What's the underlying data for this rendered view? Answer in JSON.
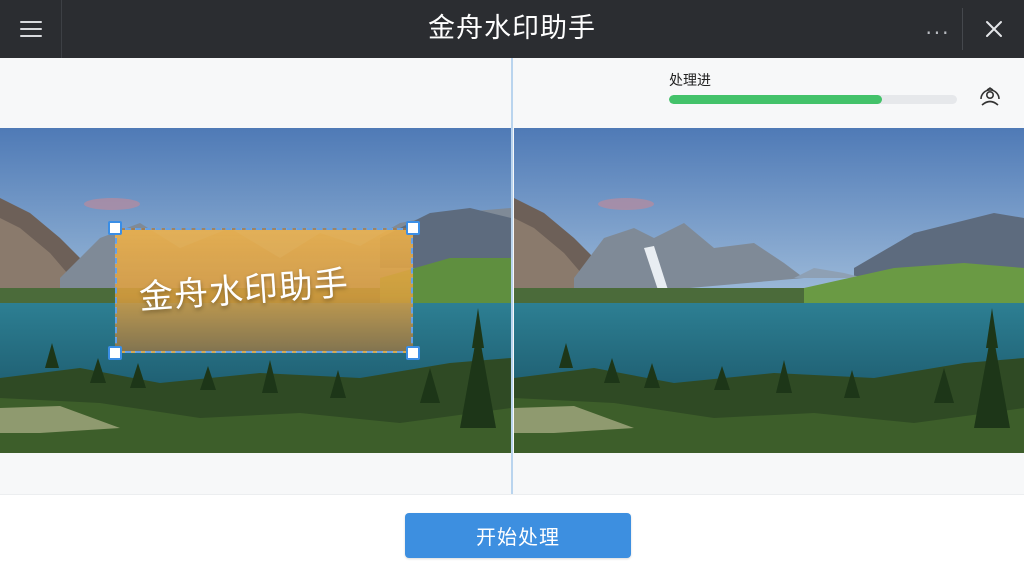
{
  "app": {
    "title": "金舟水印助手"
  },
  "titlebar": {
    "menu_icon": "hamburger-menu-icon",
    "more_icon": "more-dots-icon",
    "more_label": "···",
    "close_icon": "close-icon"
  },
  "progress": {
    "label": "处理进",
    "value_percent": 74,
    "color": "#43c26a",
    "user_icon": "user-avatar-icon"
  },
  "watermark": {
    "text": "金舟水印助手"
  },
  "actions": {
    "start_label": "开始处理",
    "accent": "#3d8fe0"
  }
}
